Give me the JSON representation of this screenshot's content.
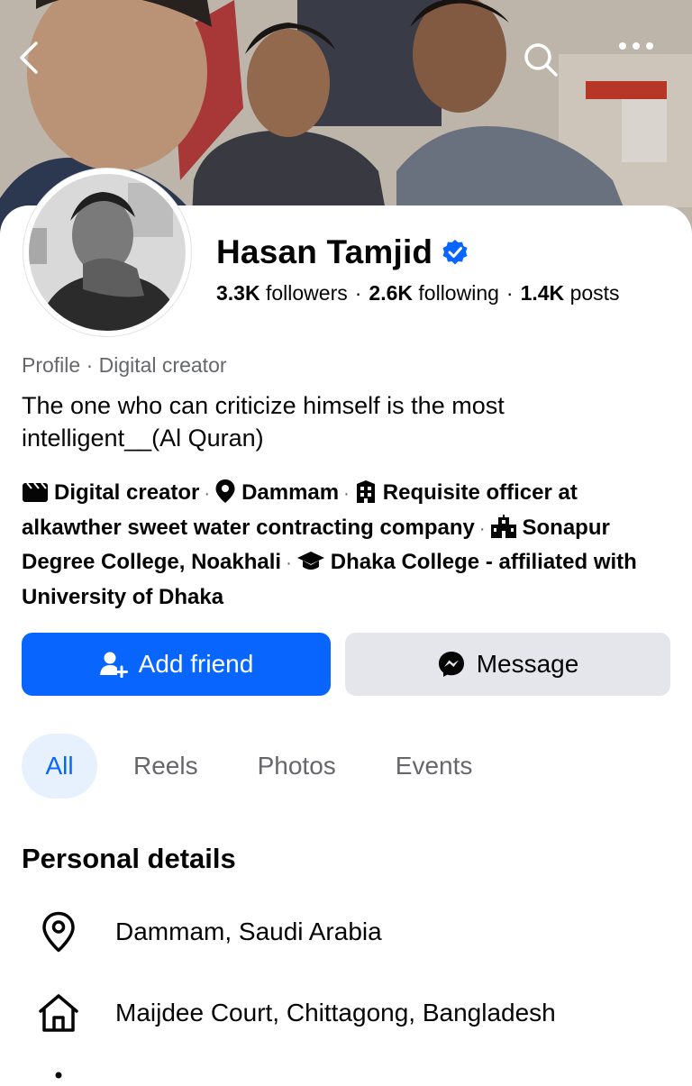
{
  "profile": {
    "name": "Hasan Tamjid",
    "stats": {
      "followers_count": "3.3K",
      "followers_label": "followers",
      "following_count": "2.6K",
      "following_label": "following",
      "posts_count": "1.4K",
      "posts_label": "posts",
      "separator": "·"
    },
    "category": "Profile · Digital creator",
    "bio": "The one who can criticize himself is the most intelligent__(Al Quran)"
  },
  "intro": {
    "items": [
      {
        "icon": "clapperboard-icon",
        "text": "Digital creator"
      },
      {
        "icon": "location-pin-icon",
        "text": "Dammam"
      },
      {
        "icon": "work-building-icon",
        "text": "Requisite officer at alkawther sweet water contracting company"
      },
      {
        "icon": "school-building-icon",
        "text": "Sonapur Degree College, Noakhali"
      },
      {
        "icon": "graduation-cap-icon",
        "text": "Dhaka College - affiliated with University of Dhaka"
      }
    ],
    "separator": "·"
  },
  "actions": {
    "add_friend_label": "Add friend",
    "message_label": "Message"
  },
  "tabs": [
    {
      "label": "All",
      "active": true
    },
    {
      "label": "Reels",
      "active": false
    },
    {
      "label": "Photos",
      "active": false
    },
    {
      "label": "Events",
      "active": false
    }
  ],
  "personal_details": {
    "title": "Personal details",
    "items": [
      {
        "icon": "location-outline-icon",
        "text": "Dammam, Saudi Arabia"
      },
      {
        "icon": "home-icon",
        "text": "Maijdee Court, Chittagong, Bangladesh"
      }
    ]
  },
  "colors": {
    "primary": "#0866ff",
    "secondary_button": "#e4e6eb",
    "active_tab_bg": "#e7f1fe",
    "muted_text": "#65676b",
    "text": "#050505"
  }
}
